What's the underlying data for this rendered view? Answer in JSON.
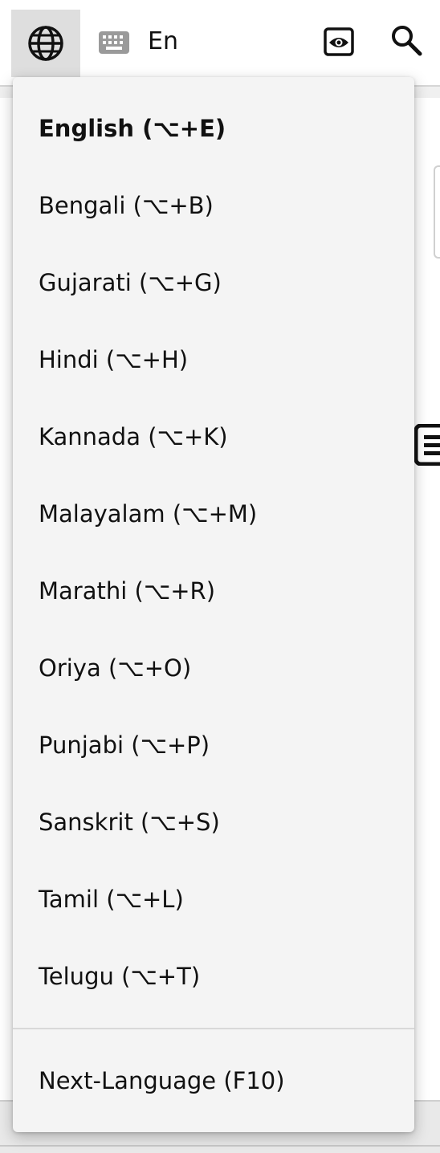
{
  "toolbar": {
    "language_code": "En",
    "icons": {
      "language": "globe-icon",
      "keyboard": "keyboard-icon",
      "preview": "eye-icon",
      "search": "search-icon"
    }
  },
  "language_menu": {
    "items": [
      {
        "label": "English (⌥+E)",
        "selected": true
      },
      {
        "label": "Bengali (⌥+B)",
        "selected": false
      },
      {
        "label": "Gujarati (⌥+G)",
        "selected": false
      },
      {
        "label": "Hindi (⌥+H)",
        "selected": false
      },
      {
        "label": "Kannada (⌥+K)",
        "selected": false
      },
      {
        "label": "Malayalam (⌥+M)",
        "selected": false
      },
      {
        "label": "Marathi (⌥+R)",
        "selected": false
      },
      {
        "label": "Oriya (⌥+O)",
        "selected": false
      },
      {
        "label": "Punjabi (⌥+P)",
        "selected": false
      },
      {
        "label": "Sanskrit (⌥+S)",
        "selected": false
      },
      {
        "label": "Tamil (⌥+L)",
        "selected": false
      },
      {
        "label": "Telugu (⌥+T)",
        "selected": false
      }
    ],
    "next_language": "Next-Language (F10)"
  },
  "colors": {
    "menu_background": "#f4f4f4",
    "active_button_background": "#dedede",
    "text": "#111111"
  }
}
